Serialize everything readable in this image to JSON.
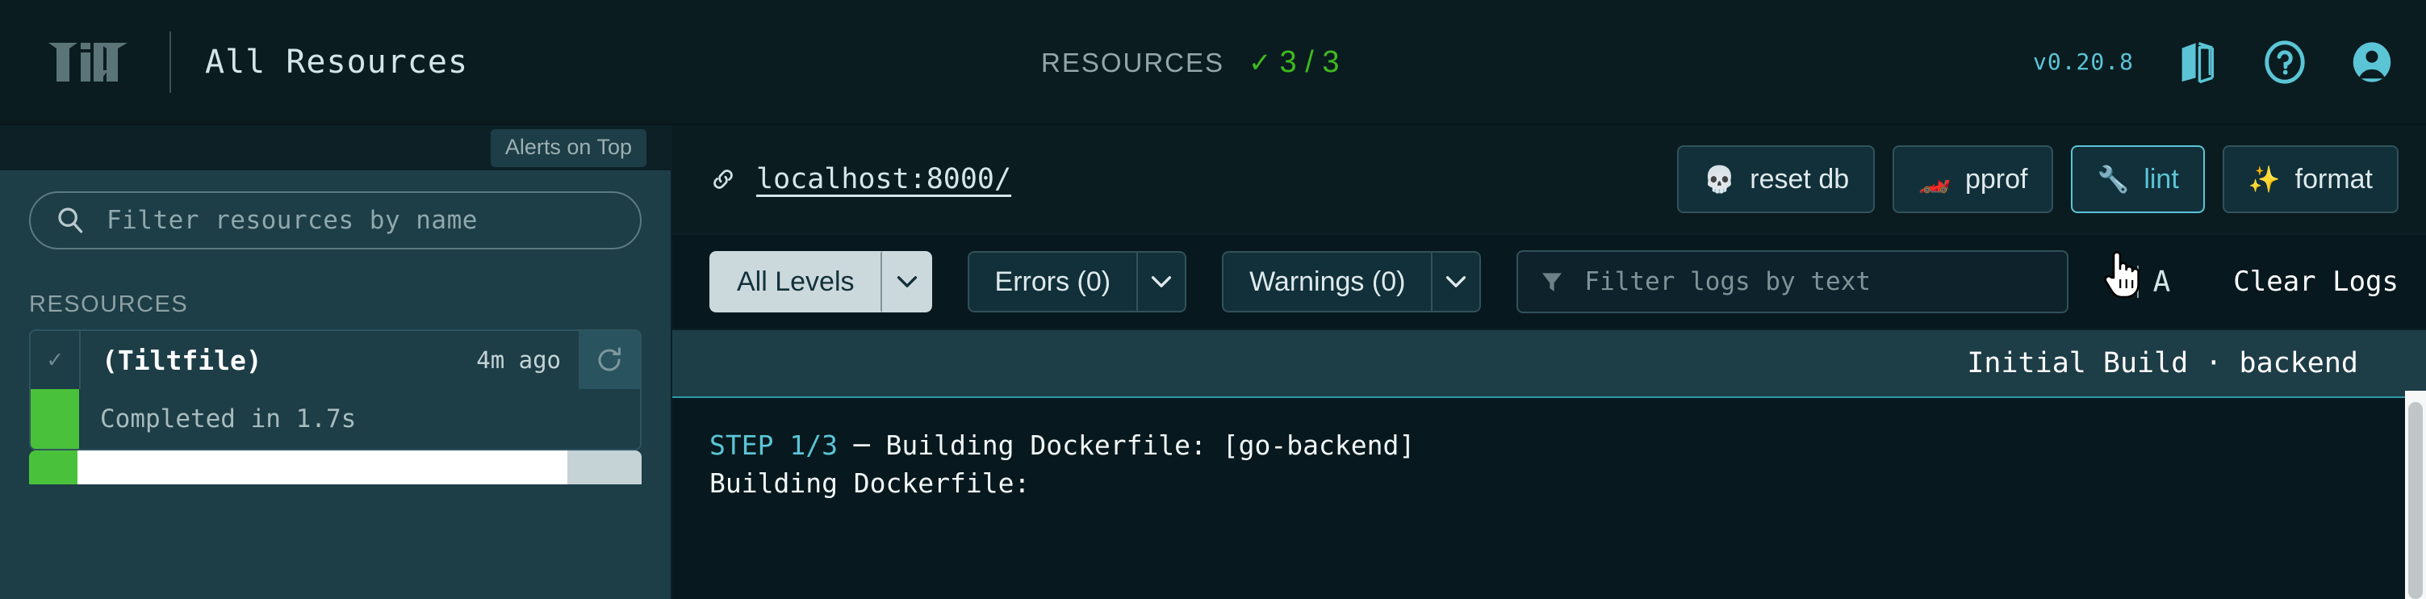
{
  "header": {
    "logo_alt": "tilt-logo",
    "title": "All Resources",
    "resources_label": "RESOURCES",
    "resources_check": "✓",
    "resources_count": "3 / 3",
    "version": "v0.20.8",
    "icons": [
      "book-icon",
      "help-circle-icon",
      "account-avatar-icon"
    ],
    "accent_color": "#5bc5d6",
    "ok_color": "#3fb91f"
  },
  "sidebar": {
    "alerts_toggle": "Alerts on Top",
    "filter": {
      "placeholder": "Filter resources by name",
      "value": ""
    },
    "section_label": "RESOURCES",
    "resources": [
      {
        "status_glyph": "✓",
        "name": "(Tiltfile)",
        "time": "4m ago",
        "trigger_icon": "reload-icon",
        "status_text": "Completed in 1.7s",
        "status_color": "#4ac13a"
      }
    ]
  },
  "main": {
    "endpoint": {
      "icon": "link-icon",
      "url": "localhost:8000/"
    },
    "buttons": [
      {
        "emoji": "💀",
        "label": "reset db",
        "active": false
      },
      {
        "emoji": "🏎️",
        "label": "pprof",
        "active": false
      },
      {
        "emoji": "🔧",
        "label": "lint",
        "active": true
      },
      {
        "emoji": "✨",
        "label": "format",
        "active": false
      }
    ],
    "log_filters": {
      "level": "All Levels",
      "errors": "Errors (0)",
      "warnings": "Warnings (0)",
      "text_filter": {
        "placeholder": "Filter logs by text",
        "value": ""
      },
      "font_small": "A",
      "font_large": "A",
      "clear_logs": "Clear Logs"
    },
    "build_header": "Initial Build · backend",
    "log_lines": [
      {
        "tag": "STEP 1/3",
        "rest": " ─ Building Dockerfile: [go-backend]"
      },
      {
        "tag": "",
        "rest": "Building Dockerfile:"
      }
    ]
  }
}
